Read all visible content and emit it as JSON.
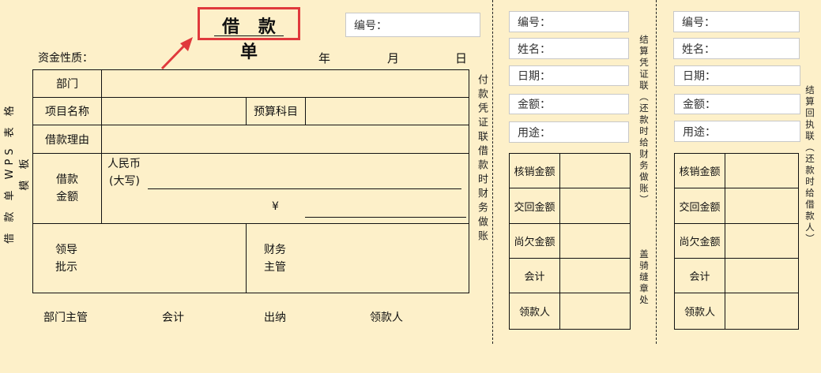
{
  "side_label": "借 款 单 WPS 表 格 模 板",
  "title": "借 款 单",
  "number_label": "编号：",
  "fund_nature_label": "资金性质：",
  "date": {
    "year": "年",
    "month": "月",
    "day": "日"
  },
  "table": {
    "department": "部门",
    "project_name": "项目名称",
    "budget_subject": "预算科目",
    "reason": "借款理由",
    "amount_label_1": "借款",
    "amount_label_2": "金额",
    "rmb": "人民币",
    "capital": "(大写)",
    "yen": "¥",
    "leader_1": "领导",
    "leader_2": "批示",
    "finance_1": "财务",
    "finance_2": "主管"
  },
  "payment_stub": "付款凭证联借款时财务做账",
  "footer": [
    "部门主管",
    "会计",
    "出纳",
    "领款人"
  ],
  "settle_stub": "结算凭证联（还款时给财务做账）",
  "seal_note": "盖骑缝章处",
  "receipt_stub": "结算回执联（还款时给借款人）",
  "panel_fields": [
    "编号：",
    "姓名：",
    "日期：",
    "金额：",
    "用途："
  ],
  "panel_rows": [
    "核销金额",
    "交回金额",
    "尚欠金额",
    "会计",
    "领款人"
  ],
  "accent": "#e0393c"
}
